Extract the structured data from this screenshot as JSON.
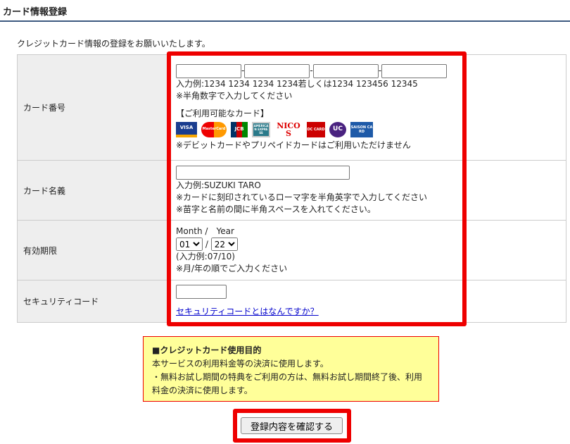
{
  "header": {
    "title": "カード情報登録"
  },
  "intro": "クレジットカード情報の登録をお願いいたします。",
  "form": {
    "card_number": {
      "label": "カード番号",
      "separator": "-",
      "example": "入力例:1234 1234 1234 1234若しくは1234 123456 12345",
      "note": "※半角数字で入力してください",
      "available_title": "【ご利用可能なカード】",
      "brands": [
        "VISA",
        "MasterCard",
        "JCB",
        "AMERICAN EXPRESS",
        "NICOS",
        "DC CARD",
        "UC",
        "SAISON CARD"
      ],
      "debit_note": "※デビットカードやプリペイドカードはご利用いただけません"
    },
    "card_name": {
      "label": "カード名義",
      "example": "入力例:SUZUKI TARO",
      "note1": "※カードに刻印されているローマ字を半角英字で入力してください",
      "note2": "※苗字と名前の間に半角スペースを入れてください。"
    },
    "expiry": {
      "label": "有効期限",
      "header": "Month /　Year",
      "month": "01",
      "year": "22",
      "slash": "/",
      "example": "(入力例:07/10)",
      "note": "※月/年の順でご入力ください"
    },
    "security": {
      "label": "セキュリティコード",
      "link": "セキュリティコードとはなんですか？"
    }
  },
  "notice": {
    "title": "■クレジットカード使用目的",
    "line1": "本サービスの利用料金等の決済に使用します。",
    "line2": "・無料お試し期間の特典をご利用の方は、無料お試し期間終了後、利用料金の決済に使用します。"
  },
  "submit_label": "登録内容を確認する",
  "colors": {
    "highlight": "#ee0000",
    "notice_bg": "#ffff99",
    "header_rule": "#3d5a80"
  }
}
